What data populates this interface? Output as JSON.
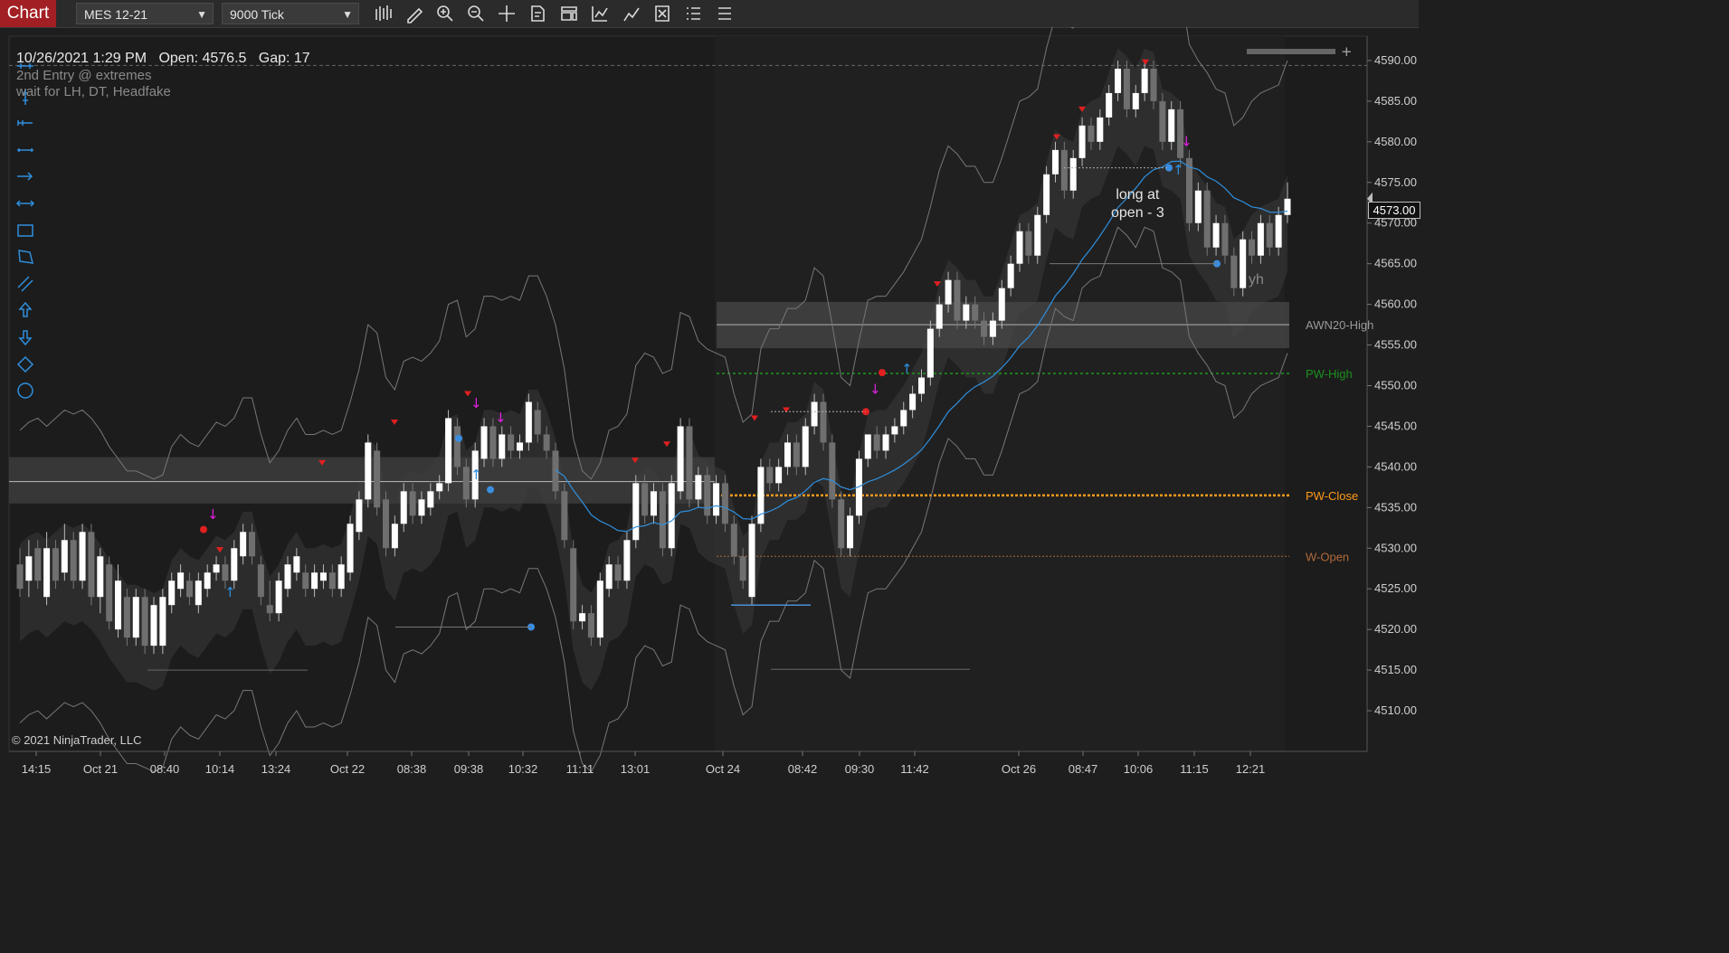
{
  "toolbar": {
    "tab_label": "Chart",
    "instrument": "MES 12-21",
    "interval": "9000 Tick",
    "icons": [
      "bar-type-icon",
      "pencil-icon",
      "zoom-in-icon",
      "zoom-out-icon",
      "crosshair-icon",
      "data-box-icon",
      "chart-properties-icon",
      "indicators-icon",
      "strategies-icon",
      "drawing-objects-icon",
      "chart-trader-icon",
      "list-icon"
    ]
  },
  "header": {
    "info_line": "10/26/2021 1:29 PM   Open: 4576.5   Gap: 17",
    "strategy_line_1": "2nd Entry @ extremes",
    "strategy_line_2": "wait for LH, DT, Headfake"
  },
  "left_tools": [
    "horizontal-line-icon",
    "vertical-line-icon",
    "ray-icon",
    "line-icon",
    "arrow-line-icon",
    "extended-line-icon",
    "rectangle-icon",
    "polygon-icon",
    "parallel-lines-icon",
    "arrow-up-icon",
    "arrow-down-icon",
    "diamond-icon",
    "ellipse-icon"
  ],
  "annotation": {
    "line1": "long at",
    "line2": "open - 3"
  },
  "yh_label": "yh",
  "copyright": "© 2021 NinjaTrader, LLC",
  "last_price": "4573.00",
  "colors": {
    "up": "#ffffff",
    "down": "#6f6f6f",
    "ema": "#2f8fdd",
    "pw_high": "#1c8f1c",
    "pw_close": "#ff9a1a",
    "w_open": "#b06a3a",
    "awn": "#9a9a9a"
  },
  "chart_data": {
    "type": "candlestick",
    "ylim": [
      4505,
      4593
    ],
    "y_ticks": [
      "4590.00",
      "4585.00",
      "4580.00",
      "4575.00",
      "4570.00",
      "4565.00",
      "4560.00",
      "4555.00",
      "4550.00",
      "4545.00",
      "4540.00",
      "4535.00",
      "4530.00",
      "4525.00",
      "4520.00",
      "4515.00",
      "4510.00"
    ],
    "x_ticks": [
      "14:15",
      "Oct 21",
      "08:40",
      "10:14",
      "13:24",
      "Oct 22",
      "08:38",
      "09:38",
      "10:32",
      "11:11",
      "13:01",
      "Oct 24",
      "08:42",
      "09:30",
      "11:42",
      "Oct 26",
      "08:47",
      "10:06",
      "11:15",
      "12:21"
    ],
    "levels": [
      {
        "label": "AWN20-High",
        "value": 4557.5
      },
      {
        "label": "PW-High",
        "value": 4551.5
      },
      {
        "label": "PW-Close",
        "value": 4536.5
      },
      {
        "label": "W-Open",
        "value": 4529.0
      }
    ],
    "candles": [
      [
        4528,
        4525,
        4530,
        4524
      ],
      [
        4526,
        4529,
        4531,
        4524
      ],
      [
        4530,
        4526,
        4531,
        4525
      ],
      [
        4524,
        4530,
        4532,
        4523
      ],
      [
        4530,
        4526,
        4531,
        4525
      ],
      [
        4527,
        4531,
        4533,
        4526
      ],
      [
        4531,
        4526,
        4532,
        4525
      ],
      [
        4526,
        4532,
        4533,
        4525
      ],
      [
        4532,
        4524,
        4533,
        4523
      ],
      [
        4524,
        4529,
        4530,
        4522
      ],
      [
        4528,
        4521,
        4529,
        4520
      ],
      [
        4520,
        4526,
        4528,
        4519
      ],
      [
        4524,
        4519,
        4525,
        4518
      ],
      [
        4519,
        4524,
        4525,
        4518
      ],
      [
        4524,
        4518,
        4525,
        4517
      ],
      [
        4518,
        4523,
        4524,
        4517
      ],
      [
        4518,
        4524,
        4525,
        4517
      ],
      [
        4523,
        4526,
        4527,
        4522
      ],
      [
        4525,
        4527,
        4528,
        4524
      ],
      [
        4526,
        4524,
        4527,
        4523
      ],
      [
        4523,
        4526,
        4527,
        4522
      ],
      [
        4525,
        4527,
        4528,
        4524
      ],
      [
        4527,
        4528,
        4529,
        4526
      ],
      [
        4528,
        4526,
        4529,
        4525
      ],
      [
        4526,
        4530,
        4531,
        4525
      ],
      [
        4529,
        4532,
        4533,
        4528
      ],
      [
        4532,
        4529,
        4533,
        4528
      ],
      [
        4528,
        4524,
        4529,
        4523
      ],
      [
        4523,
        4522,
        4526,
        4521
      ],
      [
        4522,
        4526,
        4527,
        4521
      ],
      [
        4525,
        4528,
        4529,
        4524
      ],
      [
        4527,
        4529,
        4530,
        4526
      ],
      [
        4527,
        4525,
        4528,
        4524
      ],
      [
        4525,
        4527,
        4528,
        4524
      ],
      [
        4526,
        4527,
        4528,
        4525
      ],
      [
        4527,
        4525,
        4528,
        4524
      ],
      [
        4525,
        4528,
        4529,
        4524
      ],
      [
        4527,
        4533,
        4534,
        4526
      ],
      [
        4532,
        4536,
        4537,
        4531
      ],
      [
        4536,
        4543,
        4544,
        4535
      ],
      [
        4542,
        4535,
        4543,
        4534
      ],
      [
        4536,
        4530,
        4537,
        4529
      ],
      [
        4530,
        4533,
        4534,
        4529
      ],
      [
        4533,
        4537,
        4538,
        4532
      ],
      [
        4537,
        4534,
        4538,
        4533
      ],
      [
        4534,
        4536,
        4537,
        4533
      ],
      [
        4535,
        4537,
        4538,
        4534
      ],
      [
        4537,
        4538,
        4539,
        4536
      ],
      [
        4538,
        4546,
        4547,
        4537
      ],
      [
        4545,
        4540,
        4546,
        4539
      ],
      [
        4540,
        4536,
        4541,
        4535
      ],
      [
        4536,
        4542,
        4543,
        4535
      ],
      [
        4541,
        4545,
        4546,
        4540
      ],
      [
        4545,
        4541,
        4546,
        4540
      ],
      [
        4541,
        4544,
        4545,
        4540
      ],
      [
        4544,
        4542,
        4545,
        4541
      ],
      [
        4542,
        4543,
        4544,
        4541
      ],
      [
        4543,
        4548,
        4549,
        4542
      ],
      [
        4547,
        4544,
        4548,
        4543
      ],
      [
        4544,
        4542,
        4545,
        4541
      ],
      [
        4542,
        4537,
        4543,
        4536
      ],
      [
        4537,
        4531,
        4538,
        4530
      ],
      [
        4530,
        4521,
        4531,
        4520
      ],
      [
        4521,
        4522,
        4523,
        4520
      ],
      [
        4522,
        4519,
        4523,
        4518
      ],
      [
        4519,
        4526,
        4527,
        4518
      ],
      [
        4525,
        4528,
        4529,
        4524
      ],
      [
        4528,
        4526,
        4529,
        4525
      ],
      [
        4526,
        4531,
        4532,
        4525
      ],
      [
        4531,
        4538,
        4539,
        4530
      ],
      [
        4538,
        4534,
        4539,
        4533
      ],
      [
        4534,
        4537,
        4538,
        4533
      ],
      [
        4537,
        4530,
        4538,
        4529
      ],
      [
        4530,
        4538,
        4539,
        4529
      ],
      [
        4537,
        4545,
        4546,
        4536
      ],
      [
        4545,
        4536,
        4546,
        4535
      ],
      [
        4536,
        4539,
        4540,
        4535
      ],
      [
        4539,
        4534,
        4540,
        4533
      ],
      [
        4534,
        4538,
        4539,
        4533
      ],
      [
        4538,
        4533,
        4539,
        4532
      ],
      [
        4533,
        4529,
        4534,
        4528
      ],
      [
        4529,
        4526,
        4530,
        4525
      ],
      [
        4524,
        4533,
        4534,
        4523
      ],
      [
        4533,
        4540,
        4541,
        4532
      ],
      [
        4540,
        4538,
        4541,
        4537
      ],
      [
        4538,
        4540,
        4541,
        4537
      ],
      [
        4540,
        4543,
        4544,
        4539
      ],
      [
        4543,
        4540,
        4544,
        4539
      ],
      [
        4540,
        4545,
        4546,
        4539
      ],
      [
        4545,
        4548,
        4549,
        4544
      ],
      [
        4548,
        4543,
        4549,
        4542
      ],
      [
        4543,
        4536,
        4544,
        4535
      ],
      [
        4536,
        4530,
        4537,
        4529
      ],
      [
        4530,
        4534,
        4535,
        4529
      ],
      [
        4534,
        4541,
        4542,
        4533
      ],
      [
        4541,
        4544,
        4542,
        4540
      ],
      [
        4544,
        4542,
        4545,
        4541
      ],
      [
        4542,
        4544,
        4545,
        4541
      ],
      [
        4544,
        4545,
        4546,
        4543
      ],
      [
        4545,
        4547,
        4548,
        4544
      ],
      [
        4547,
        4549,
        4550,
        4546
      ],
      [
        4549,
        4551,
        4552,
        4548
      ],
      [
        4551,
        4557,
        4558,
        4550
      ],
      [
        4557,
        4560,
        4561,
        4556
      ],
      [
        4560,
        4563,
        4564,
        4559
      ],
      [
        4563,
        4558,
        4564,
        4557
      ],
      [
        4558,
        4560,
        4561,
        4557
      ],
      [
        4560,
        4558,
        4561,
        4557
      ],
      [
        4558,
        4556,
        4559,
        4555
      ],
      [
        4556,
        4558,
        4559,
        4555
      ],
      [
        4558,
        4562,
        4563,
        4557
      ],
      [
        4562,
        4565,
        4566,
        4561
      ],
      [
        4565,
        4569,
        4570,
        4564
      ],
      [
        4569,
        4566,
        4570,
        4565
      ],
      [
        4566,
        4571,
        4572,
        4565
      ],
      [
        4571,
        4576,
        4577,
        4570
      ],
      [
        4576,
        4579,
        4580,
        4575
      ],
      [
        4579,
        4574,
        4580,
        4573
      ],
      [
        4574,
        4578,
        4579,
        4573
      ],
      [
        4578,
        4582,
        4583,
        4577
      ],
      [
        4582,
        4580,
        4583,
        4579
      ],
      [
        4580,
        4583,
        4584,
        4579
      ],
      [
        4583,
        4586,
        4587,
        4582
      ],
      [
        4586,
        4589,
        4590,
        4585
      ],
      [
        4589,
        4584,
        4590,
        4583
      ],
      [
        4584,
        4586,
        4587,
        4583
      ],
      [
        4586,
        4589,
        4590,
        4585
      ],
      [
        4589,
        4585,
        4590,
        4584
      ],
      [
        4585,
        4580,
        4586,
        4579
      ],
      [
        4580,
        4584,
        4585,
        4579
      ],
      [
        4584,
        4578,
        4585,
        4577
      ],
      [
        4578,
        4570,
        4579,
        4569
      ],
      [
        4570,
        4574,
        4575,
        4569
      ],
      [
        4574,
        4567,
        4575,
        4566
      ],
      [
        4567,
        4570,
        4571,
        4566
      ],
      [
        4570,
        4566,
        4571,
        4565
      ],
      [
        4566,
        4562,
        4567,
        4561
      ],
      [
        4562,
        4568,
        4569,
        4561
      ],
      [
        4568,
        4566,
        4569,
        4565
      ],
      [
        4566,
        4570,
        4571,
        4565
      ],
      [
        4570,
        4567,
        4571,
        4566
      ],
      [
        4567,
        4571,
        4572,
        4566
      ],
      [
        4571,
        4573,
        4575,
        4570
      ]
    ]
  }
}
